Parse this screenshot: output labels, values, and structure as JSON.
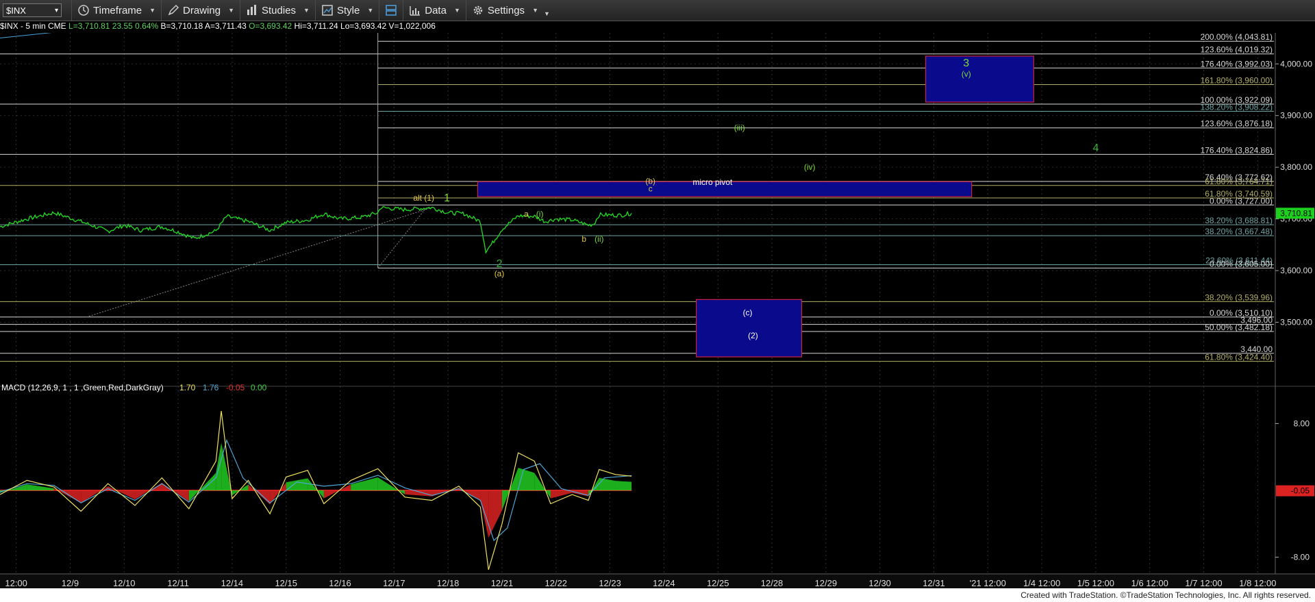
{
  "toolbar": {
    "symbol": "$INX",
    "timeframe_label": "Timeframe",
    "drawing_label": "Drawing",
    "studies_label": "Studies",
    "style_label": "Style",
    "data_label": "Data",
    "settings_label": "Settings"
  },
  "quote": {
    "symbol_desc": "$INX - 5 min  CME",
    "last": "L=3,710.81",
    "change": "23.55",
    "pct": "0.64%",
    "bid": "B=3,710.18",
    "ask": "A=3,711.43",
    "open": "O=3,693.42",
    "high": "Hi=3,711.24",
    "low": "Lo=3,693.42",
    "volume": "V=1,022,006"
  },
  "colors": {
    "price": "#22dd22",
    "white_fib": "#d8d8d8",
    "olive_fib": "#b3b066",
    "teal_fib": "#6fa3a3",
    "box_fill": "#0a0a8c",
    "box_border": "#cc2244",
    "label_green": "#7ddb3a",
    "label_yellow": "#e0c84a",
    "dark_green": "#36b23a"
  },
  "chart_data": {
    "type": "line",
    "title": "$INX - 5 min",
    "ylim": [
      3400,
      4060
    ],
    "y_ticks": [
      3500,
      3600,
      3700,
      3800,
      3900,
      4000
    ],
    "y_tick_labels": [
      "3,500.00",
      "3,600.00",
      "3,700.00",
      "3,800.00",
      "3,900.00",
      "4,000.00"
    ],
    "x_tick_labels": [
      "12:00",
      "12/9",
      "12/10",
      "12/11",
      "12/14",
      "12/15",
      "12/16",
      "12/17",
      "12/18",
      "12/21",
      "12/22",
      "12/23",
      "12/24",
      "12/25",
      "12/28",
      "12/29",
      "12/30",
      "12/31",
      "'21 12:00",
      "1/4 12:00",
      "1/5 12:00",
      "1/6 12:00",
      "1/7 12:00",
      "1/8 12:00"
    ],
    "x_index_range": [
      0,
      23.6
    ],
    "last_price": "3,710.81",
    "series": [
      {
        "type": "line",
        "points": [
          [
            0,
            3685
          ],
          [
            0.5,
            3700
          ],
          [
            1,
            3712
          ],
          [
            1.5,
            3695
          ],
          [
            2,
            3676
          ],
          [
            2.3,
            3688
          ],
          [
            2.6,
            3678
          ],
          [
            3,
            3685
          ],
          [
            3.3,
            3675
          ],
          [
            3.6,
            3662
          ],
          [
            4,
            3677
          ],
          [
            4.2,
            3705
          ],
          [
            4.6,
            3695
          ],
          [
            5,
            3678
          ],
          [
            5.3,
            3693
          ],
          [
            5.7,
            3698
          ],
          [
            6,
            3710
          ],
          [
            6.3,
            3700
          ],
          [
            6.7,
            3703
          ],
          [
            7,
            3712
          ],
          [
            7.05,
            3722
          ],
          [
            7.5,
            3718
          ],
          [
            8,
            3722
          ],
          [
            8.3,
            3712
          ],
          [
            8.6,
            3710
          ],
          [
            8.9,
            3695
          ],
          [
            9,
            3638
          ],
          [
            9.1,
            3650
          ],
          [
            9.3,
            3680
          ],
          [
            9.6,
            3706
          ],
          [
            9.9,
            3705
          ],
          [
            10.1,
            3695
          ],
          [
            10.3,
            3700
          ],
          [
            10.6,
            3698
          ],
          [
            10.9,
            3688
          ],
          [
            11,
            3690
          ],
          [
            11.1,
            3708
          ],
          [
            11.5,
            3707
          ],
          [
            11.7,
            3711
          ]
        ]
      }
    ],
    "fib_levels_right": [
      {
        "label": "200.00% (4,043.81)",
        "value": 4043.81,
        "color": "white"
      },
      {
        "label": "123.60% (4,019.32)",
        "value": 4019.32,
        "color": "white"
      },
      {
        "label": "176.40% (3,992.03)",
        "value": 3992.03,
        "color": "white"
      },
      {
        "label": "161.80% (3,960.00)",
        "value": 3960.0,
        "color": "olive"
      },
      {
        "label": "100.00% (3,922.09)",
        "value": 3922.09,
        "color": "white"
      },
      {
        "label": "138.20% (3,908.22)",
        "value": 3908.22,
        "color": "teal"
      },
      {
        "label": "123.60% (3,876.18)",
        "value": 3876.18,
        "color": "white"
      },
      {
        "label": "176.40% (3,824.86)",
        "value": 3824.86,
        "color": "white"
      },
      {
        "label": "76.40% (3,772.62)",
        "value": 3772.62,
        "color": "white"
      },
      {
        "label": "61.80% (3,764.71)",
        "value": 3764.71,
        "color": "olive"
      },
      {
        "label": "61.80% (3,740.59)",
        "value": 3740.59,
        "color": "olive"
      },
      {
        "label": "0.00% (3,727.00)",
        "value": 3727.0,
        "color": "white"
      },
      {
        "label": "38.20% (3,688.81)",
        "value": 3688.81,
        "color": "teal"
      },
      {
        "label": "38.20% (3,667.48)",
        "value": 3667.48,
        "color": "teal"
      },
      {
        "label": "23.60% (3,611.44)",
        "value": 3611.44,
        "color": "teal"
      },
      {
        "label": "0.00% (3,605.00)",
        "value": 3605.0,
        "color": "white"
      },
      {
        "label": "38.20% (3,539.96)",
        "value": 3539.96,
        "color": "olive"
      },
      {
        "label": "0.00% (3,510.10)",
        "value": 3510.1,
        "color": "white"
      },
      {
        "label": "3,496.00",
        "value": 3496.0,
        "color": "white"
      },
      {
        "label": "50.00% (3,482.18)",
        "value": 3482.18,
        "color": "white"
      },
      {
        "label": "3,440.00",
        "value": 3440.0,
        "color": "white"
      },
      {
        "label": "61.80% (3,424.40)",
        "value": 3424.4,
        "color": "olive"
      }
    ],
    "annotations": [
      {
        "text": "3",
        "x": 17.9,
        "y": 3995,
        "color": "green",
        "size": "big"
      },
      {
        "text": "(v)",
        "x": 17.9,
        "y": 3975,
        "color": "green",
        "size": "small"
      },
      {
        "text": "(iii)",
        "x": 13.7,
        "y": 3871,
        "color": "green",
        "size": "small"
      },
      {
        "text": "4",
        "x": 20.3,
        "y": 3831,
        "color": "green",
        "size": "big"
      },
      {
        "text": "(iv)",
        "x": 15.0,
        "y": 3795,
        "color": "green",
        "size": "small"
      },
      {
        "text": "(b)",
        "x": 12.05,
        "y": 3768,
        "color": "yellow",
        "size": "small"
      },
      {
        "text": "c",
        "x": 12.05,
        "y": 3753,
        "color": "yellow",
        "size": "small"
      },
      {
        "text": "micro pivot",
        "x": 13.2,
        "y": 3766,
        "color": "white",
        "size": "small"
      },
      {
        "text": "alt (1)",
        "x": 7.85,
        "y": 3735,
        "color": "yellow",
        "size": "small"
      },
      {
        "text": "1",
        "x": 8.28,
        "y": 3734,
        "color": "green",
        "size": "big"
      },
      {
        "text": "a",
        "x": 9.75,
        "y": 3704,
        "color": "yellow",
        "size": "small"
      },
      {
        "text": "(i)",
        "x": 10.0,
        "y": 3704,
        "color": "green",
        "size": "small"
      },
      {
        "text": "b",
        "x": 10.82,
        "y": 3656,
        "color": "yellow",
        "size": "small"
      },
      {
        "text": "(ii)",
        "x": 11.1,
        "y": 3656,
        "color": "green",
        "size": "small"
      },
      {
        "text": "2",
        "x": 9.25,
        "y": 3607,
        "color": "green",
        "size": "big"
      },
      {
        "text": "(a)",
        "x": 9.25,
        "y": 3589,
        "color": "yellow",
        "size": "small"
      },
      {
        "text": "(c)",
        "x": 13.85,
        "y": 3513,
        "color": "white",
        "size": "small"
      },
      {
        "text": "(2)",
        "x": 13.95,
        "y": 3469,
        "color": "white",
        "size": "small"
      }
    ],
    "boxes": [
      {
        "name": "wave-3-target-box",
        "x0": 17.15,
        "x1": 19.15,
        "y0": 3926,
        "y1": 4015
      },
      {
        "name": "micro-pivot-box",
        "x0": 8.85,
        "x1": 18.0,
        "y0": 3743,
        "y1": 3772
      },
      {
        "name": "wave-2-target-box",
        "x0": 12.9,
        "x1": 14.85,
        "y0": 3433,
        "y1": 3544
      }
    ],
    "macd": {
      "label": "MACD (12,26,9, 1 , 1 ,Green,Red,DarkGray)",
      "macd_value": "1.70",
      "signal_value": "1.76",
      "hist_value": "-0.05",
      "zero_value": "0.00",
      "ylim": [
        -10,
        10
      ],
      "y_tick_labels": [
        "8.00",
        "-8.00"
      ],
      "y_ticks": [
        8,
        -8
      ],
      "current_label": "-0.05",
      "macd_points": [
        [
          0,
          -0.5
        ],
        [
          0.5,
          1.2
        ],
        [
          1,
          0.4
        ],
        [
          1.5,
          -2.5
        ],
        [
          2,
          0.8
        ],
        [
          2.5,
          -1.8
        ],
        [
          3,
          1.5
        ],
        [
          3.5,
          -2.2
        ],
        [
          4,
          3.5
        ],
        [
          4.1,
          9.5
        ],
        [
          4.3,
          -1.0
        ],
        [
          4.6,
          1.2
        ],
        [
          5,
          -2.8
        ],
        [
          5.3,
          1.6
        ],
        [
          5.7,
          2.4
        ],
        [
          6,
          -1.6
        ],
        [
          6.5,
          1.2
        ],
        [
          7,
          2.6
        ],
        [
          7.5,
          -0.8
        ],
        [
          8,
          -1.2
        ],
        [
          8.5,
          0.5
        ],
        [
          8.9,
          -2.0
        ],
        [
          9.05,
          -9.5
        ],
        [
          9.3,
          -4.0
        ],
        [
          9.6,
          4.5
        ],
        [
          9.9,
          3.5
        ],
        [
          10.2,
          -1.6
        ],
        [
          10.6,
          -0.5
        ],
        [
          10.9,
          -1.2
        ],
        [
          11.1,
          2.5
        ],
        [
          11.4,
          1.9
        ],
        [
          11.7,
          1.7
        ]
      ],
      "signal_points": [
        [
          0,
          -0.2
        ],
        [
          0.5,
          0.8
        ],
        [
          1,
          0.6
        ],
        [
          1.5,
          -1.5
        ],
        [
          2,
          0.2
        ],
        [
          2.5,
          -1.2
        ],
        [
          3,
          0.8
        ],
        [
          3.5,
          -1.4
        ],
        [
          4,
          1.5
        ],
        [
          4.2,
          6.0
        ],
        [
          4.5,
          1.5
        ],
        [
          5,
          -1.5
        ],
        [
          5.5,
          1.0
        ],
        [
          6,
          0.5
        ],
        [
          6.5,
          0.8
        ],
        [
          7,
          1.8
        ],
        [
          7.5,
          0.3
        ],
        [
          8,
          -0.6
        ],
        [
          8.5,
          0.2
        ],
        [
          8.9,
          -1.2
        ],
        [
          9.15,
          -6.0
        ],
        [
          9.4,
          -4.5
        ],
        [
          9.7,
          2.5
        ],
        [
          10.0,
          3.2
        ],
        [
          10.4,
          0.2
        ],
        [
          10.9,
          -0.6
        ],
        [
          11.2,
          1.5
        ],
        [
          11.7,
          1.76
        ]
      ]
    }
  },
  "footer": {
    "text": "Created with TradeStation. ©TradeStation Technologies, Inc. All rights reserved."
  }
}
